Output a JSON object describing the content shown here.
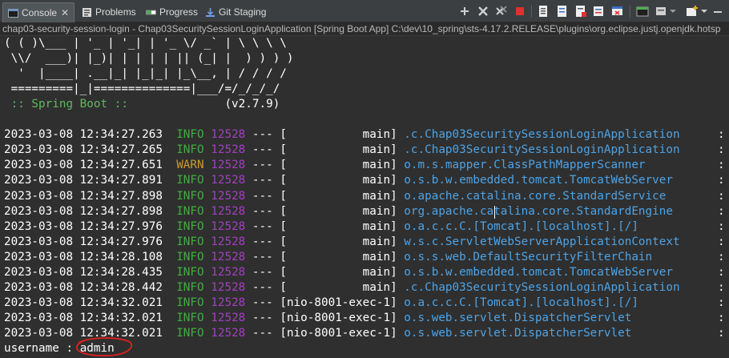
{
  "tabs": [
    {
      "label": "Console",
      "icon": "console-icon",
      "active": true
    },
    {
      "label": "Problems",
      "icon": "problems-icon",
      "active": false
    },
    {
      "label": "Progress",
      "icon": "progress-icon",
      "active": false
    },
    {
      "label": "Git Staging",
      "icon": "git-staging-icon",
      "active": false
    }
  ],
  "toolbar_icons": [
    "collapse-icon",
    "remove-launch-icon",
    "remove-all-terminated-icon",
    "terminate-icon",
    "scroll-lock-icon",
    "show-console-stdout-icon",
    "show-console-stderr-icon",
    "word-wrap-icon",
    "pin-console-icon",
    "display-selected-console-icon",
    "dropdown-icon",
    "open-console-icon",
    "dropdown-icon",
    "minimize-icon",
    "maximize-icon"
  ],
  "console_description": "chap03-security-session-login - Chap03SecuritySessionLoginApplication [Spring Boot App] C:\\dev\\10_spring\\sts-4.17.2.RELEASE\\plugins\\org.eclipse.justj.openjdk.hotsp",
  "banner": [
    "( ( )\\___ | '_ | '_| | '_ \\/ _` | \\ \\ \\ \\",
    " \\\\/  ___)| |_)| | | | | || (_| |  ) ) ) )",
    "  '  |____| .__|_| |_|_| |_\\__, | / / / /",
    " =========|_|==============|___/=/_/_/_/"
  ],
  "spring_boot_label": " :: Spring Boot :: ",
  "spring_boot_version": "(v2.7.9)",
  "log_lines": [
    {
      "time": "2023-03-08 12:34:27.263",
      "level": "INFO",
      "pid": "12528",
      "sep": "---",
      "thread": "[           main]",
      "logger": ".c.Chap03SecuritySessionLoginApplication",
      "colon": ":"
    },
    {
      "time": "2023-03-08 12:34:27.265",
      "level": "INFO",
      "pid": "12528",
      "sep": "---",
      "thread": "[           main]",
      "logger": ".c.Chap03SecuritySessionLoginApplication",
      "colon": ":"
    },
    {
      "time": "2023-03-08 12:34:27.651",
      "level": "WARN",
      "pid": "12528",
      "sep": "---",
      "thread": "[           main]",
      "logger": "o.m.s.mapper.ClassPathMapperScanner",
      "colon": ":"
    },
    {
      "time": "2023-03-08 12:34:27.891",
      "level": "INFO",
      "pid": "12528",
      "sep": "---",
      "thread": "[           main]",
      "logger": "o.s.b.w.embedded.tomcat.TomcatWebServer",
      "colon": ":"
    },
    {
      "time": "2023-03-08 12:34:27.898",
      "level": "INFO",
      "pid": "12528",
      "sep": "---",
      "thread": "[           main]",
      "logger": "o.apache.catalina.core.StandardService",
      "colon": ":"
    },
    {
      "time": "2023-03-08 12:34:27.898",
      "level": "INFO",
      "pid": "12528",
      "sep": "---",
      "thread": "[           main]",
      "logger": "org.apache.catalina.core.StandardEngine",
      "colon": ":"
    },
    {
      "time": "2023-03-08 12:34:27.976",
      "level": "INFO",
      "pid": "12528",
      "sep": "---",
      "thread": "[           main]",
      "logger": "o.a.c.c.C.[Tomcat].[localhost].[/]",
      "colon": ":"
    },
    {
      "time": "2023-03-08 12:34:27.976",
      "level": "INFO",
      "pid": "12528",
      "sep": "---",
      "thread": "[           main]",
      "logger": "w.s.c.ServletWebServerApplicationContext",
      "colon": ":"
    },
    {
      "time": "2023-03-08 12:34:28.108",
      "level": "INFO",
      "pid": "12528",
      "sep": "---",
      "thread": "[           main]",
      "logger": "o.s.s.web.DefaultSecurityFilterChain",
      "colon": ":"
    },
    {
      "time": "2023-03-08 12:34:28.435",
      "level": "INFO",
      "pid": "12528",
      "sep": "---",
      "thread": "[           main]",
      "logger": "o.s.b.w.embedded.tomcat.TomcatWebServer",
      "colon": ":"
    },
    {
      "time": "2023-03-08 12:34:28.442",
      "level": "INFO",
      "pid": "12528",
      "sep": "---",
      "thread": "[           main]",
      "logger": ".c.Chap03SecuritySessionLoginApplication",
      "colon": ":"
    },
    {
      "time": "2023-03-08 12:34:32.021",
      "level": "INFO",
      "pid": "12528",
      "sep": "---",
      "thread": "[nio-8001-exec-1]",
      "logger": "o.a.c.c.C.[Tomcat].[localhost].[/]",
      "colon": ":"
    },
    {
      "time": "2023-03-08 12:34:32.021",
      "level": "INFO",
      "pid": "12528",
      "sep": "---",
      "thread": "[nio-8001-exec-1]",
      "logger": "o.s.web.servlet.DispatcherServlet",
      "colon": ":"
    },
    {
      "time": "2023-03-08 12:34:32.021",
      "level": "INFO",
      "pid": "12528",
      "sep": "---",
      "thread": "[nio-8001-exec-1]",
      "logger": "o.s.web.servlet.DispatcherServlet",
      "colon": ":"
    }
  ],
  "prompt": {
    "label": "username : ",
    "value": "admin"
  },
  "colors": {
    "info": "#3fae3f",
    "warn": "#d09a2a",
    "pid": "#a23fbf",
    "logger": "#4da3e6",
    "annotation": "#e02020"
  }
}
